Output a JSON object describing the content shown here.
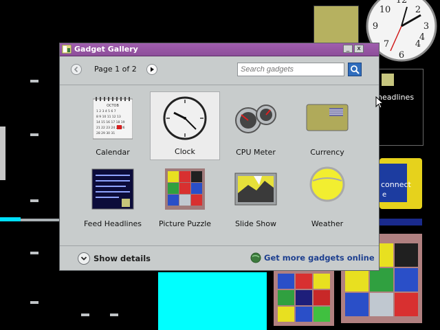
{
  "window": {
    "title": "Gadget Gallery",
    "minimize": "_",
    "close": "x"
  },
  "toolbar": {
    "page_label": "Page 1 of 2",
    "search_placeholder": "Search gadgets"
  },
  "gadgets": [
    {
      "label": "Calendar"
    },
    {
      "label": "Clock"
    },
    {
      "label": "CPU Meter"
    },
    {
      "label": "Currency"
    },
    {
      "label": "Feed Headlines"
    },
    {
      "label": "Picture Puzzle"
    },
    {
      "label": "Slide Show"
    },
    {
      "label": "Weather"
    }
  ],
  "footer": {
    "show_details": "Show details",
    "get_more": "Get more gadgets online"
  },
  "desktop": {
    "feed_headlines_fragment": "headlines",
    "connect_fragment": "connect",
    "connect_sub": "e"
  },
  "calendar_thumb": {
    "month": "OCTOB"
  },
  "colors": {
    "titlebar": "#9455a3",
    "window_bg": "#c8cccc",
    "link": "#1d3f8f",
    "desktop": "#000000"
  }
}
